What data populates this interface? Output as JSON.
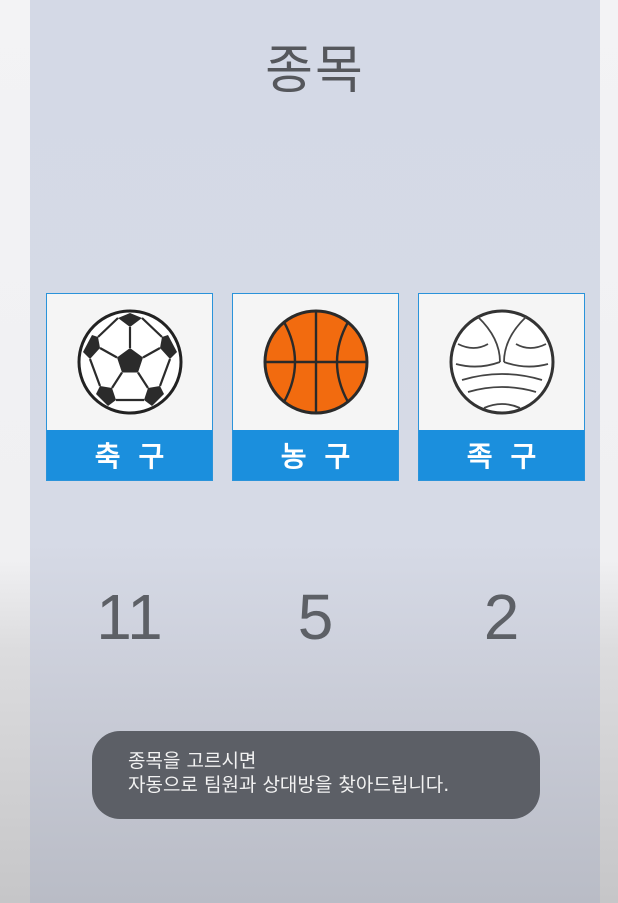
{
  "header": {
    "title": "종목"
  },
  "sports": [
    {
      "icon": "soccer-ball-icon",
      "label": "축구",
      "count": "11"
    },
    {
      "icon": "basketball-icon",
      "label": "농구",
      "count": "5"
    },
    {
      "icon": "volleyball-icon",
      "label": "족구",
      "count": "2"
    }
  ],
  "toast": {
    "line1": "종목을 고르시면",
    "line2": "자동으로 팀원과 상대방을 찾아드립니다."
  },
  "colors": {
    "accent": "#1b8fdd",
    "card_border": "#2a93da",
    "basketball": "#f26b0f",
    "toast_bg": "#5c5f66"
  }
}
